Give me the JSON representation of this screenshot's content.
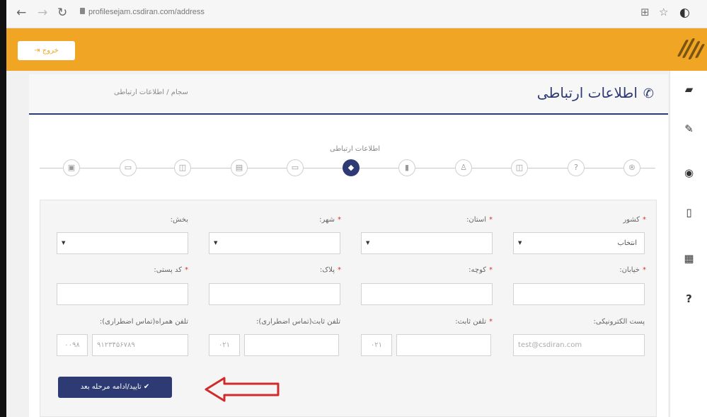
{
  "browser": {
    "url": "profilesejam.csdiran.com/address",
    "back": "←",
    "forward": "→",
    "reload": "↻"
  },
  "header": {
    "logout_label": "خروج",
    "logout_icon": "sign-out-icon",
    "brand_color": "#f0a525"
  },
  "page": {
    "title": "اطلاعات ارتباطی",
    "title_icon": "phone-icon",
    "breadcrumb": "سجام / اطلاعات ارتباطی",
    "accent_color": "#2e3a73"
  },
  "stepper": {
    "active_label": "اطلاعات ارتباطی",
    "steps": [
      {
        "icon": "id-card-icon",
        "glyph": "▣"
      },
      {
        "icon": "credit-card-icon",
        "glyph": "▭"
      },
      {
        "icon": "money-icon",
        "glyph": "◫"
      },
      {
        "icon": "briefcase-icon",
        "glyph": "▤"
      },
      {
        "icon": "bank-card-icon",
        "glyph": "▭"
      },
      {
        "icon": "graduation-cap-icon",
        "glyph": "◆"
      },
      {
        "icon": "bookmark-icon",
        "glyph": "▮"
      },
      {
        "icon": "person-icon",
        "glyph": "♙"
      },
      {
        "icon": "cash-icon",
        "glyph": "◫"
      },
      {
        "icon": "question-icon",
        "glyph": "?"
      },
      {
        "icon": "registered-icon",
        "glyph": "®"
      }
    ]
  },
  "form": {
    "country": {
      "label": "کشور",
      "value": "انتخاب"
    },
    "province": {
      "label": "استان:"
    },
    "city": {
      "label": "شهر:"
    },
    "district": {
      "label": "بخش:"
    },
    "street": {
      "label": "خیابان:"
    },
    "alley": {
      "label": "کوچه:"
    },
    "plate": {
      "label": "پلاک:"
    },
    "postal": {
      "label": "کد پستی:"
    },
    "email": {
      "label": "پست الکترونیکی:",
      "placeholder": "test@csdiran.com"
    },
    "phone": {
      "label": "تلفن ثابت:",
      "prefix": "۰۲۱"
    },
    "emergency_phone": {
      "label": "تلفن ثابت(تماس اضطراری):",
      "prefix": "۰۲۱"
    },
    "emergency_mobile": {
      "label": "تلفن همراه(تماس اضطراری):",
      "prefix": "۰۰۹۸",
      "placeholder": "۹۱۲۳۴۵۶۷۸۹"
    },
    "submit_label": "✔ تایید/ادامه مرحله بعد"
  },
  "sidebar": {
    "items": [
      {
        "icon": "book-icon",
        "glyph": "▰"
      },
      {
        "icon": "edit-icon",
        "glyph": "✎"
      },
      {
        "icon": "eye-icon",
        "glyph": "◉"
      },
      {
        "icon": "mobile-icon",
        "glyph": "▯"
      },
      {
        "icon": "building-icon",
        "glyph": "▦"
      },
      {
        "icon": "help-icon",
        "glyph": "?"
      }
    ]
  }
}
